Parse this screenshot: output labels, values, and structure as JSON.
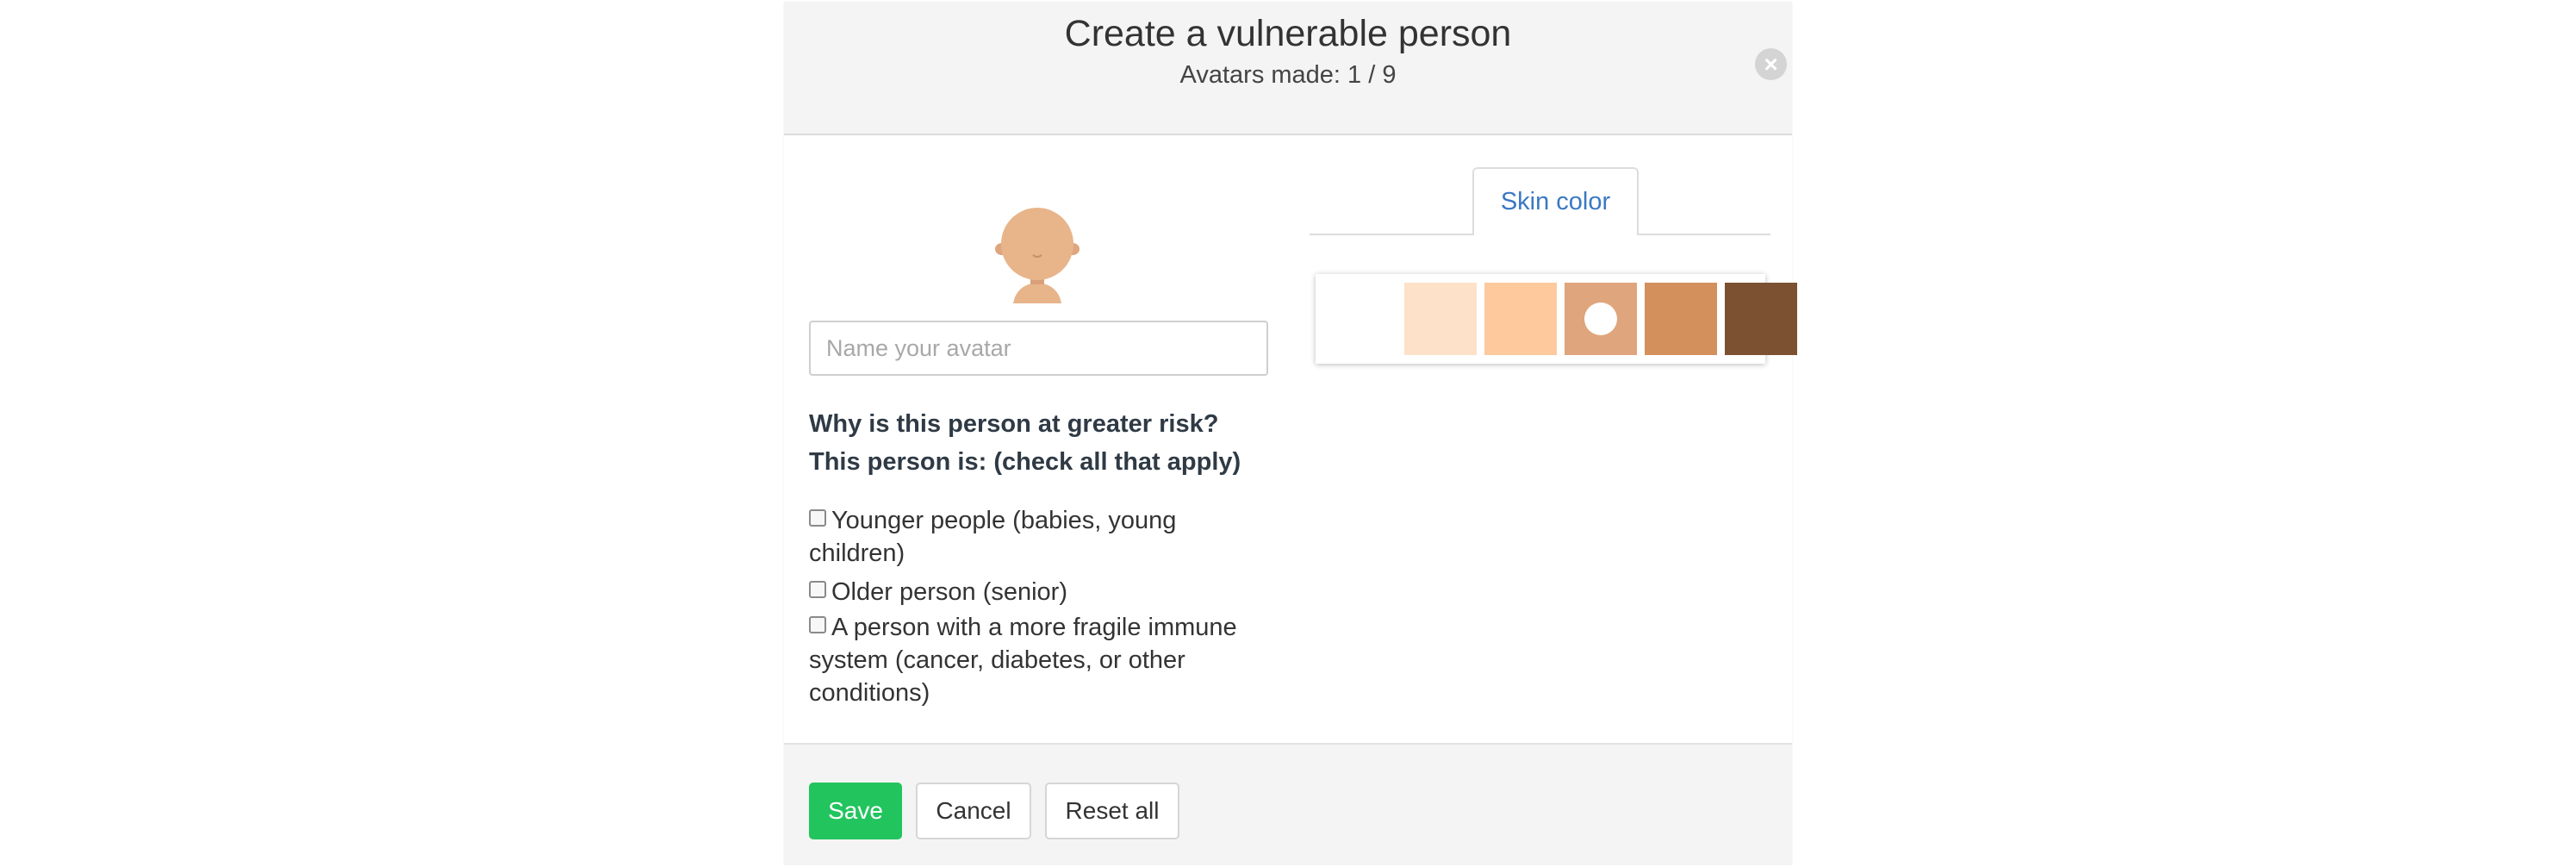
{
  "header": {
    "title": "Create a vulnerable person",
    "subtitle": "Avatars made: 1 / 9",
    "close_icon": "close-icon"
  },
  "avatar": {
    "icon": "baby-avatar-icon",
    "skin_color": "#e8b48a"
  },
  "name_input": {
    "value": "",
    "placeholder": "Name your avatar"
  },
  "risk": {
    "question": "Why is this person at greater risk?",
    "instruction": "This person is: (check all that apply)",
    "options": [
      {
        "label": "Younger people (babies, young children)",
        "checked": false
      },
      {
        "label": "Older person (senior)",
        "checked": false
      },
      {
        "label": "A person with a more fragile immune system (cancer, diabetes, or other conditions)",
        "checked": false
      }
    ]
  },
  "tabs": {
    "skin_color": "Skin color"
  },
  "skin_palette": {
    "selected_index": 3,
    "swatches": [
      "#ffffff",
      "#fde1c8",
      "#fdc99d",
      "#dfa57c",
      "#d3905d",
      "#7b5132"
    ]
  },
  "footer": {
    "save_label": "Save",
    "cancel_label": "Cancel",
    "reset_label": "Reset all"
  },
  "colors": {
    "accent_green": "#22c45e",
    "tab_blue": "#3a78c3",
    "header_bg": "#f4f4f4"
  }
}
